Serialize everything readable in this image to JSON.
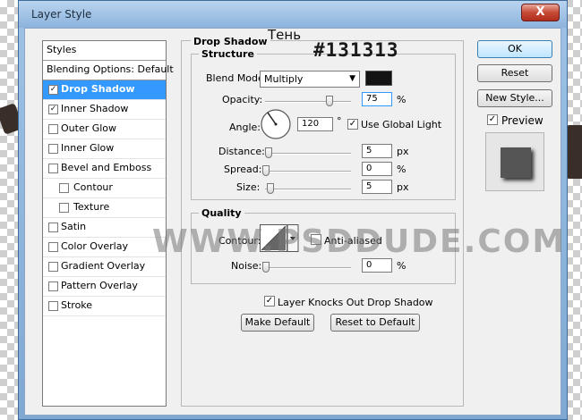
{
  "window": {
    "title": "Layer Style",
    "close_glyph": "X"
  },
  "styles_list": {
    "header": "Styles",
    "blending": "Blending Options: Default",
    "items": [
      {
        "label": "Drop Shadow",
        "checked": true,
        "selected": true,
        "indent": false
      },
      {
        "label": "Inner Shadow",
        "checked": true,
        "selected": false,
        "indent": false
      },
      {
        "label": "Outer Glow",
        "checked": false,
        "selected": false,
        "indent": false
      },
      {
        "label": "Inner Glow",
        "checked": false,
        "selected": false,
        "indent": false
      },
      {
        "label": "Bevel and Emboss",
        "checked": false,
        "selected": false,
        "indent": false
      },
      {
        "label": "Contour",
        "checked": false,
        "selected": false,
        "indent": true
      },
      {
        "label": "Texture",
        "checked": false,
        "selected": false,
        "indent": true
      },
      {
        "label": "Satin",
        "checked": false,
        "selected": false,
        "indent": false
      },
      {
        "label": "Color Overlay",
        "checked": false,
        "selected": false,
        "indent": false
      },
      {
        "label": "Gradient Overlay",
        "checked": false,
        "selected": false,
        "indent": false
      },
      {
        "label": "Pattern Overlay",
        "checked": false,
        "selected": false,
        "indent": false
      },
      {
        "label": "Stroke",
        "checked": false,
        "selected": false,
        "indent": false
      }
    ]
  },
  "drop_shadow": {
    "title": "Drop Shadow",
    "structure": {
      "title": "Structure",
      "blend_mode_label": "Blend Mode:",
      "blend_mode_value": "Multiply",
      "shadow_color": "#131313",
      "opacity_label": "Opacity:",
      "opacity_value": "75",
      "opacity_fraction": 0.75,
      "percent": "%",
      "angle_label": "Angle:",
      "angle_value": "120",
      "degree": "°",
      "use_global_light": "Use Global Light",
      "use_global_light_checked": true,
      "distance_label": "Distance:",
      "distance_value": "5",
      "spread_label": "Spread:",
      "spread_value": "0",
      "size_label": "Size:",
      "size_value": "5",
      "px": "px"
    },
    "quality": {
      "title": "Quality",
      "contour_label": "Contour:",
      "anti_aliased": "Anti-aliased",
      "anti_aliased_checked": false,
      "noise_label": "Noise:",
      "noise_value": "0",
      "percent": "%"
    },
    "knocks_out": "Layer Knocks Out Drop Shadow",
    "knocks_out_checked": true,
    "make_default": "Make Default",
    "reset_to_default": "Reset to Default"
  },
  "actions": {
    "ok": "OK",
    "reset": "Reset",
    "new_style": "New Style...",
    "preview": "Preview",
    "preview_checked": true
  },
  "overlay": {
    "ten": "Тень",
    "hex": "#131313",
    "watermark": "WWW.PSDDUDE.COM"
  }
}
